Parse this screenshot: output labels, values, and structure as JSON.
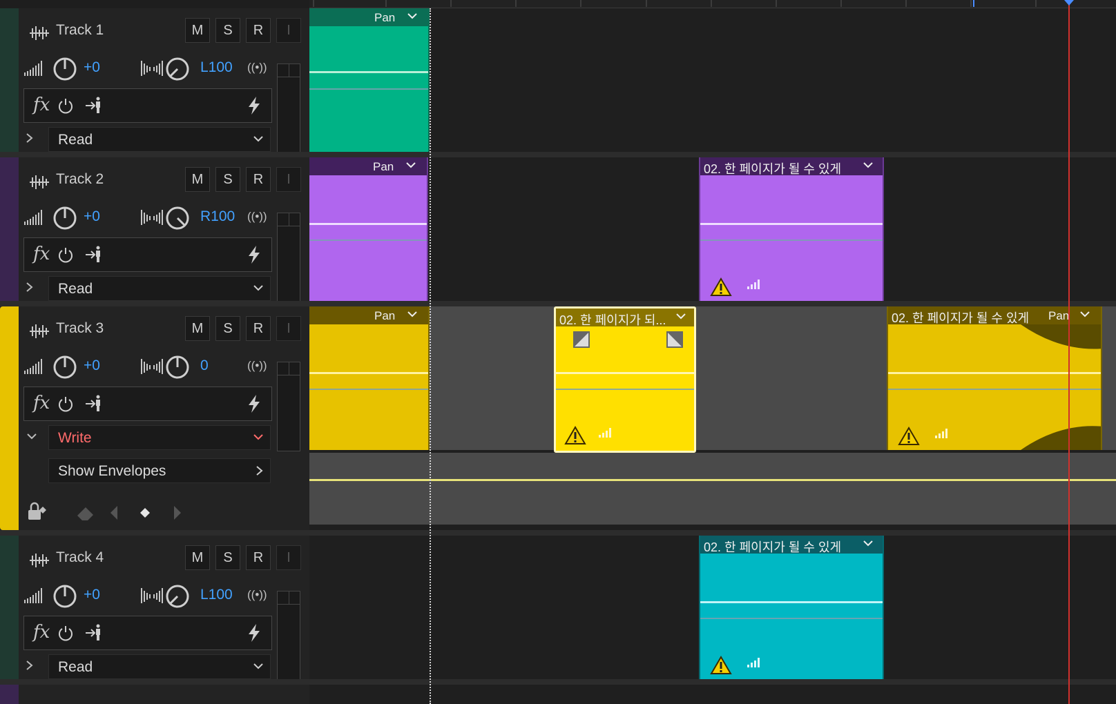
{
  "tracks": [
    {
      "name": "Track 1",
      "color": "#00b386",
      "mute": "M",
      "solo": "S",
      "arm": "R",
      "input": "I",
      "volume": "+0",
      "pan": "L100",
      "automation_mode": "Read"
    },
    {
      "name": "Track 2",
      "color": "#b066ee",
      "mute": "M",
      "solo": "S",
      "arm": "R",
      "input": "I",
      "volume": "+0",
      "pan": "R100",
      "automation_mode": "Read"
    },
    {
      "name": "Track 3",
      "color": "#e7c200",
      "mute": "M",
      "solo": "S",
      "arm": "R",
      "input": "I",
      "volume": "+0",
      "pan": "0",
      "automation_mode": "Write",
      "show_envelopes": "Show Envelopes"
    },
    {
      "name": "Track 4",
      "color": "#00b8c4",
      "mute": "M",
      "solo": "S",
      "arm": "R",
      "input": "I",
      "volume": "+0",
      "pan": "L100",
      "automation_mode": "Read"
    }
  ],
  "clips": {
    "t1a": {
      "pan_label": "Pan"
    },
    "t2a": {
      "pan_label": "Pan"
    },
    "t2b": {
      "title": "02. 한 페이지가 될 수 있게"
    },
    "t3a": {
      "pan_label": "Pan"
    },
    "t3b": {
      "title": "02. 한 페이지가 되..."
    },
    "t3c": {
      "title": "02. 한 페이지가 될 수 있게",
      "pan_label": "Pan"
    },
    "t4a": {
      "title": "02. 한 페이지가 될 수 있게"
    }
  },
  "colors": {
    "playhead": "#d0312d",
    "volume_text": "#42a1ff",
    "write_mode": "#ff6b6b",
    "selected_clip": "#ffe000"
  },
  "icons": [
    "waveform-icon",
    "volume-meter-icon",
    "volume-knob-icon",
    "pan-meter-icon",
    "pan-knob-icon",
    "broadcast-icon",
    "fx-icon",
    "power-icon",
    "insert-icon",
    "lightning-icon",
    "chevron-right-icon",
    "chevron-down-icon",
    "lock-keyframe-icon",
    "eraser-icon",
    "prev-keyframe-icon",
    "add-keyframe-icon",
    "next-keyframe-icon",
    "warning-icon",
    "level-bars-icon"
  ]
}
